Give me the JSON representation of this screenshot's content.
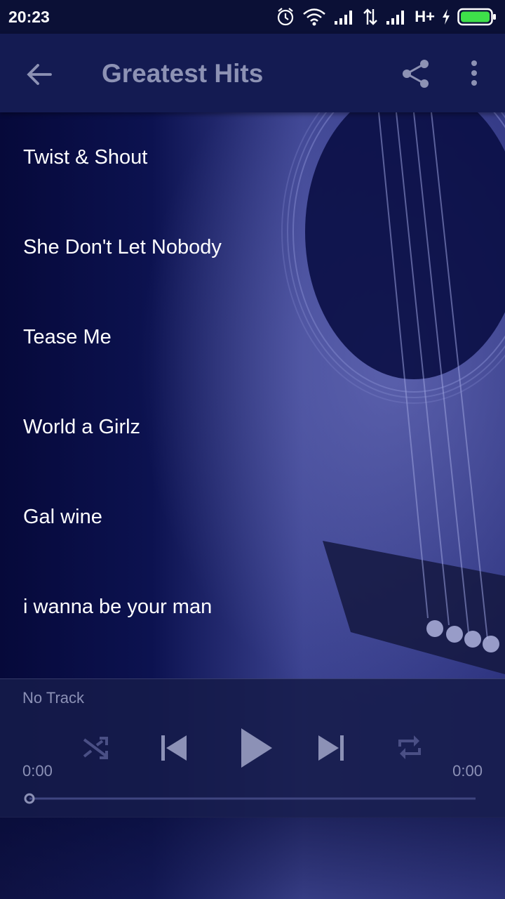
{
  "status_bar": {
    "time": "20:23",
    "network_label": "H+"
  },
  "app_bar": {
    "title": "Greatest Hits"
  },
  "tracks": [
    "Twist & Shout",
    "She Don't Let Nobody",
    "Tease Me",
    "World a Girlz",
    "Gal wine",
    "i wanna be your man"
  ],
  "player": {
    "now_playing": "No Track",
    "elapsed": "0:00",
    "duration": "0:00",
    "progress": 0
  },
  "colors": {
    "app_bar": "#141b52",
    "title_text": "#8d92b4",
    "player_text": "#8c91b6",
    "battery": "#3ee04a"
  },
  "icons": [
    "back-arrow-icon",
    "share-icon",
    "more-vert-icon",
    "shuffle-icon",
    "skip-previous-icon",
    "play-icon",
    "skip-next-icon",
    "repeat-icon",
    "alarm-icon",
    "wifi-icon",
    "signal-icon",
    "data-arrows-icon",
    "charging-icon",
    "battery-icon"
  ]
}
